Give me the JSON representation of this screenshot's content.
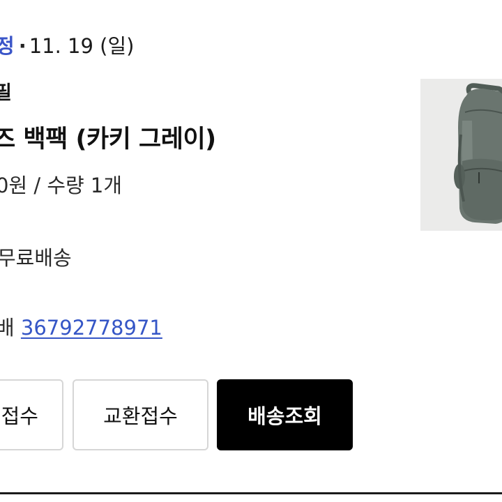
{
  "order": {
    "status": "정",
    "separator": "·",
    "date": "11. 19 (일)"
  },
  "product": {
    "brand": "필",
    "name": "즈 백팩 (카키 그레이)",
    "price_quantity": "0원 / 수량 1개",
    "image_icon": "backpack-khaki-gray-photo"
  },
  "shipping": {
    "fee_text": "무료배송"
  },
  "tracking": {
    "prefix": "배",
    "number": "36792778971"
  },
  "actions": {
    "return_label": "접수",
    "exchange_label": "교환접수",
    "track_label": "배송조회"
  },
  "colors": {
    "status_blue": "#3a55c8",
    "link_blue": "#3556c6",
    "primary_button": "#000000"
  }
}
